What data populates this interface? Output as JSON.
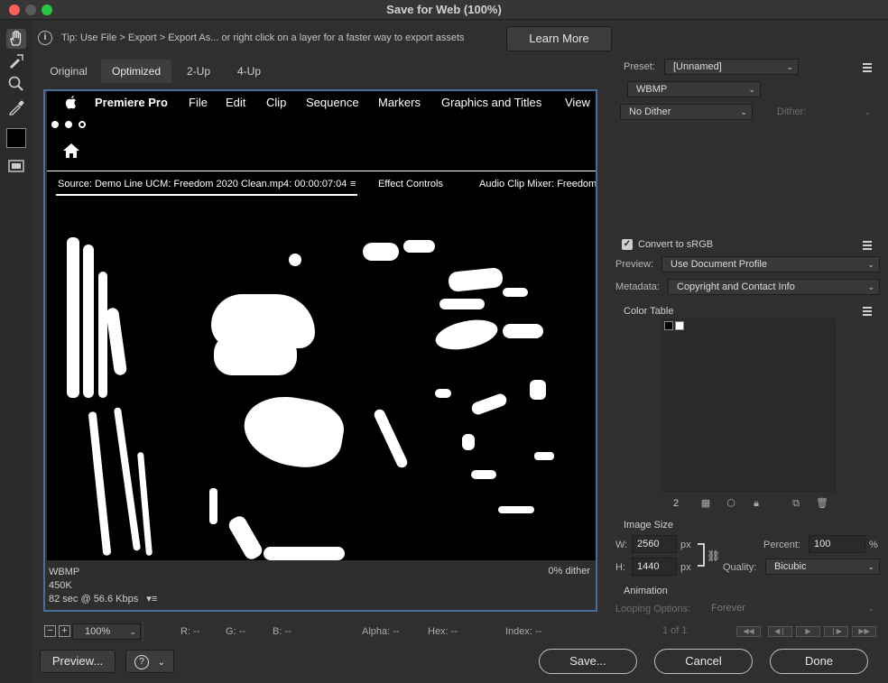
{
  "window": {
    "title": "Save for Web (100%)",
    "colors": {
      "close": "#ff5f57",
      "minimize": "#5a5a5a",
      "zoom": "#28c840",
      "canvas_border": "#4a6e9a"
    }
  },
  "tools": [
    "hand-tool-icon",
    "slice-select-icon",
    "zoom-tool-icon",
    "eyedropper-icon",
    "color-swatch",
    "slice-visibility-icon"
  ],
  "tip": {
    "text": "Tip: Use File > Export > Export As...  or right click on a layer for a faster way to export assets",
    "learn_more": "Learn More"
  },
  "tabs": [
    "Original",
    "Optimized",
    "2-Up",
    "4-Up"
  ],
  "active_tab": "Optimized",
  "preview_image": {
    "menu_items": [
      "Premiere Pro",
      "File",
      "Edit",
      "Clip",
      "Sequence",
      "Markers",
      "Graphics and Titles",
      "View"
    ],
    "source_label": "Source: Demo Line UCM: Freedom 2020 Clean.mp4: 00:00:07:04",
    "effect_controls": "Effect Controls",
    "audio_mixer": "Audio Clip Mixer: Freedom"
  },
  "image_info": {
    "format": "WBMP",
    "size": "450K",
    "download_time": "82 sec @ 56.6 Kbps",
    "dither_info": "0% dither"
  },
  "statusbar": {
    "zoom": "100%",
    "r": "R: --",
    "g": "G: --",
    "b": "B: --",
    "alpha": "Alpha: --",
    "hex": "Hex: --",
    "index": "Index: --"
  },
  "settings": {
    "preset_label": "Preset:",
    "preset_value": "[Unnamed]",
    "format_value": "WBMP",
    "dither_algorithm": "No Dither",
    "dither_label": "Dither:",
    "dither_value": "",
    "convert_srgb_label": "Convert to sRGB",
    "convert_srgb_checked": true,
    "preview_label": "Preview:",
    "preview_value": "Use Document Profile",
    "metadata_label": "Metadata:",
    "metadata_value": "Copyright and Contact Info",
    "color_table_label": "Color Table",
    "color_count": "2"
  },
  "image_size": {
    "header": "Image Size",
    "w_label": "W:",
    "width": "2560",
    "h_label": "H:",
    "height": "1440",
    "unit": "px",
    "percent_label": "Percent:",
    "percent": "100",
    "percent_unit": "%",
    "quality_label": "Quality:",
    "quality": "Bicubic"
  },
  "animation": {
    "header": "Animation",
    "looping_label": "Looping Options:",
    "looping_value": "Forever",
    "frame_counter": "1 of 1"
  },
  "buttons": {
    "preview": "Preview...",
    "save": "Save...",
    "cancel": "Cancel",
    "done": "Done"
  }
}
